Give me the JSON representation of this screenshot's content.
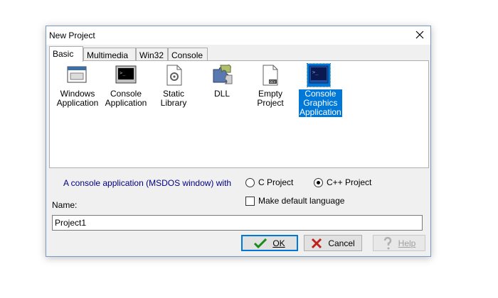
{
  "dialog": {
    "title": "New Project",
    "close_icon": "close-icon"
  },
  "tabs": [
    {
      "label": "Basic",
      "active": true
    },
    {
      "label": "Multimedia",
      "active": false
    },
    {
      "label": "Win32",
      "active": false
    },
    {
      "label": "Console",
      "active": false
    }
  ],
  "templates": [
    {
      "label": "Windows\nApplication",
      "icon": "windows-application-icon",
      "selected": false
    },
    {
      "label": "Console\nApplication",
      "icon": "console-application-icon",
      "selected": false
    },
    {
      "label": "Static Library",
      "icon": "static-library-icon",
      "selected": false
    },
    {
      "label": "DLL",
      "icon": "dll-icon",
      "selected": false
    },
    {
      "label": "Empty\nProject",
      "icon": "empty-project-icon",
      "selected": false
    },
    {
      "label": "Console\nGraphics\nApplication",
      "icon": "console-graphics-application-icon",
      "selected": true
    }
  ],
  "description": "A console application (MSDOS window) with",
  "language": {
    "options": [
      {
        "label": "C Project",
        "selected": false
      },
      {
        "label": "C++ Project",
        "selected": true
      }
    ],
    "default_checkbox_label": "Make default language",
    "default_checked": false
  },
  "name": {
    "label": "Name:",
    "value": "Project1"
  },
  "buttons": {
    "ok": {
      "label": "OK",
      "icon": "checkmark-icon"
    },
    "cancel": {
      "label": "Cancel",
      "icon": "x-mark-icon"
    },
    "help": {
      "label": "Help",
      "icon": "question-mark-icon",
      "disabled": true
    }
  },
  "colors": {
    "selection": "#0078d7",
    "description_text": "#000080",
    "ok_check": "#1a8a1a",
    "cancel_x": "#c0201a"
  }
}
